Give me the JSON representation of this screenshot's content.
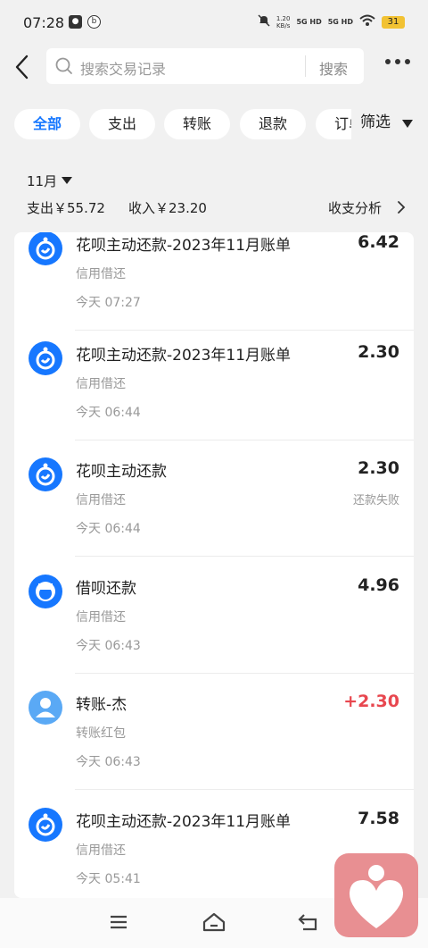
{
  "status_bar": {
    "time": "07:28",
    "left_icons": [
      "notification-icon",
      "app-icon"
    ],
    "net_speed_value": "1.20",
    "net_speed_unit": "KB/s",
    "sim1": "5G HD",
    "sim2": "5G HD",
    "battery": "31"
  },
  "search": {
    "placeholder": "搜索交易记录",
    "button": "搜索"
  },
  "filters": {
    "chips": [
      "全部",
      "支出",
      "转账",
      "退款",
      "订单"
    ],
    "active": "全部",
    "filter_label": "筛选"
  },
  "summary": {
    "month": "11月",
    "expense": "支出￥55.72",
    "income": "收入￥23.20",
    "analysis_label": "收支分析"
  },
  "transactions": [
    {
      "title": "花呗主动还款-2023年11月账单",
      "category": "信用借还",
      "time": "今天 07:27",
      "amount": "6.42",
      "status": "",
      "icon": "huabei-icon"
    },
    {
      "title": "花呗主动还款-2023年11月账单",
      "category": "信用借还",
      "time": "今天 06:44",
      "amount": "2.30",
      "status": "",
      "icon": "huabei-icon"
    },
    {
      "title": "花呗主动还款",
      "category": "信用借还",
      "time": "今天 06:44",
      "amount": "2.30",
      "status": "还款失败",
      "icon": "huabei-icon"
    },
    {
      "title": "借呗还款",
      "category": "信用借还",
      "time": "今天 06:43",
      "amount": "4.96",
      "status": "",
      "icon": "jiebei-icon"
    },
    {
      "title": "转账-杰",
      "category": "转账红包",
      "time": "今天 06:43",
      "amount": "+2.30",
      "status": "",
      "icon": "person-avatar-icon"
    },
    {
      "title": "花呗主动还款-2023年11月账单",
      "category": "信用借还",
      "time": "今天 05:41",
      "amount": "7.58",
      "status": "",
      "icon": "huabei-icon"
    }
  ],
  "colors": {
    "accent": "#1677ff",
    "income": "#e8474f",
    "background": "#f1f1f1",
    "float_button": "#e88f92"
  },
  "nav": {
    "icons": [
      "menu-icon",
      "home-icon",
      "back-nav-icon"
    ]
  }
}
